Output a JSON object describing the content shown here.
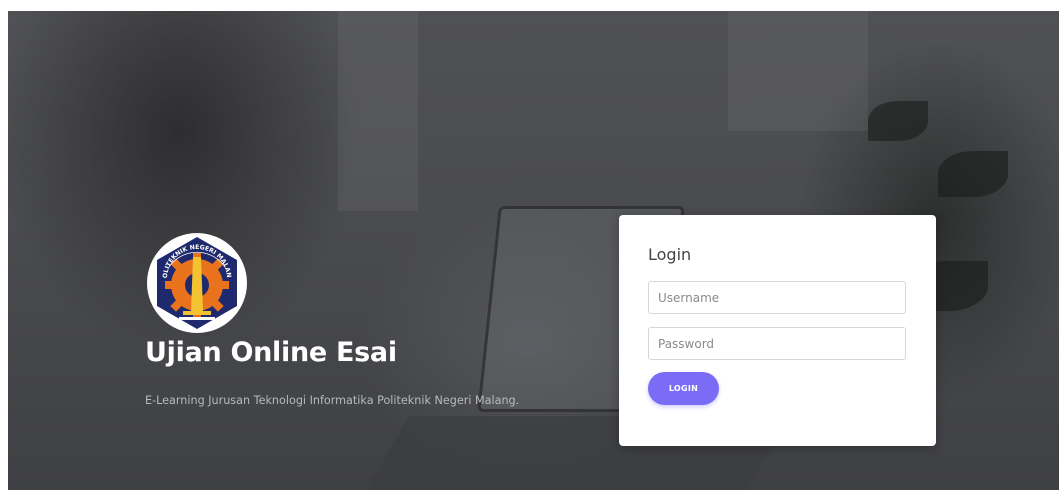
{
  "hero": {
    "logo_text": "POLITEKNIK NEGERI MALANG",
    "title": "Ujian Online Esai",
    "subtitle": "E-Learning Jurusan Teknologi Informatika Politeknik Negeri Malang."
  },
  "login": {
    "title": "Login",
    "username_placeholder": "Username",
    "username_value": "",
    "password_placeholder": "Password",
    "password_value": "",
    "button_label": "LOGIN"
  },
  "colors": {
    "accent": "#7b6cf6",
    "logo_navy": "#1f2a6e",
    "logo_orange": "#e8731c",
    "logo_gold": "#f2c230"
  },
  "icons": {
    "logo": "polinema-emblem"
  }
}
